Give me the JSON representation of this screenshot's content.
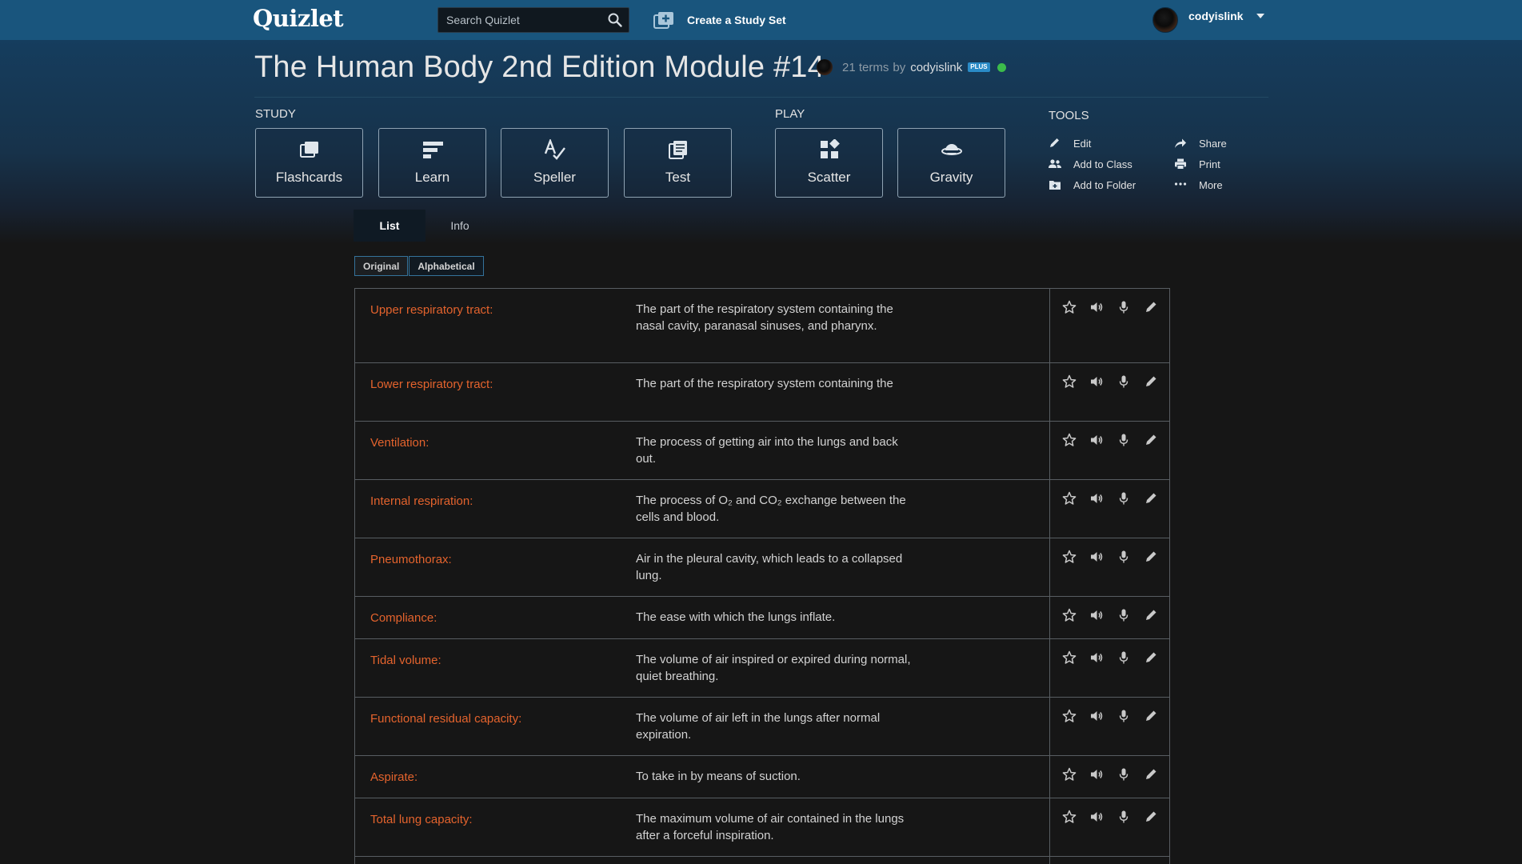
{
  "app": {
    "logo": "Quizlet"
  },
  "topnav": {
    "search_placeholder": "Search Quizlet",
    "create_label": "Create a Study Set",
    "username": "codyislink"
  },
  "set": {
    "title": "The Human Body 2nd Edition Module #14",
    "terms_count": "21 terms",
    "by": "by",
    "creator": "codyislink",
    "plus_badge": "PLUS"
  },
  "study": {
    "heading": "STUDY",
    "modes": [
      {
        "label": "Flashcards",
        "icon": "flashcards-icon"
      },
      {
        "label": "Learn",
        "icon": "learn-icon"
      },
      {
        "label": "Speller",
        "icon": "speller-icon"
      },
      {
        "label": "Test",
        "icon": "test-icon"
      }
    ]
  },
  "play": {
    "heading": "PLAY",
    "modes": [
      {
        "label": "Scatter",
        "icon": "scatter-icon"
      },
      {
        "label": "Gravity",
        "icon": "gravity-icon"
      }
    ]
  },
  "tools": {
    "heading": "TOOLS",
    "items": [
      {
        "label": "Edit",
        "icon": "pencil-icon"
      },
      {
        "label": "Share",
        "icon": "share-icon"
      },
      {
        "label": "Add to Class",
        "icon": "class-icon"
      },
      {
        "label": "Print",
        "icon": "print-icon"
      },
      {
        "label": "Add to Folder",
        "icon": "folder-icon"
      },
      {
        "label": "More",
        "icon": "more-icon"
      }
    ]
  },
  "tabs": [
    {
      "label": "List",
      "active": true
    },
    {
      "label": "Info",
      "active": false
    }
  ],
  "sort": {
    "original": "Original",
    "alphabetical": "Alphabetical",
    "active": "Original"
  },
  "colors": {
    "nav": "#19557d",
    "term": "#e4632d",
    "online": "#3cbc4b",
    "plus": "#2a8bc7"
  },
  "terms": [
    {
      "word": "Upper respiratory tract:",
      "definition": "The part of the respiratory system containing the nasal cavity, paranasal sinuses, and pharynx."
    },
    {
      "word": "Lower respiratory tract:",
      "definition": "The part of the respiratory system containing the"
    },
    {
      "word": "Ventilation:",
      "definition": "The process of getting air into the lungs and back out."
    },
    {
      "word": "Internal respiration:",
      "definition": "The process of O₂ and CO₂ exchange between the cells and blood."
    },
    {
      "word": "Pneumothorax:",
      "definition": "Air in the pleural cavity, which leads to a collapsed lung."
    },
    {
      "word": "Compliance:",
      "definition": "The ease with which the lungs inflate."
    },
    {
      "word": "Tidal volume:",
      "definition": "The volume of air inspired or expired during normal, quiet breathing."
    },
    {
      "word": "Functional residual capacity:",
      "definition": "The volume of air left in the lungs after normal expiration."
    },
    {
      "word": "Aspirate:",
      "definition": "To take in by means of suction."
    },
    {
      "word": "Total lung capacity:",
      "definition": "The maximum volume of air contained in the lungs after a forceful inspiration."
    }
  ]
}
